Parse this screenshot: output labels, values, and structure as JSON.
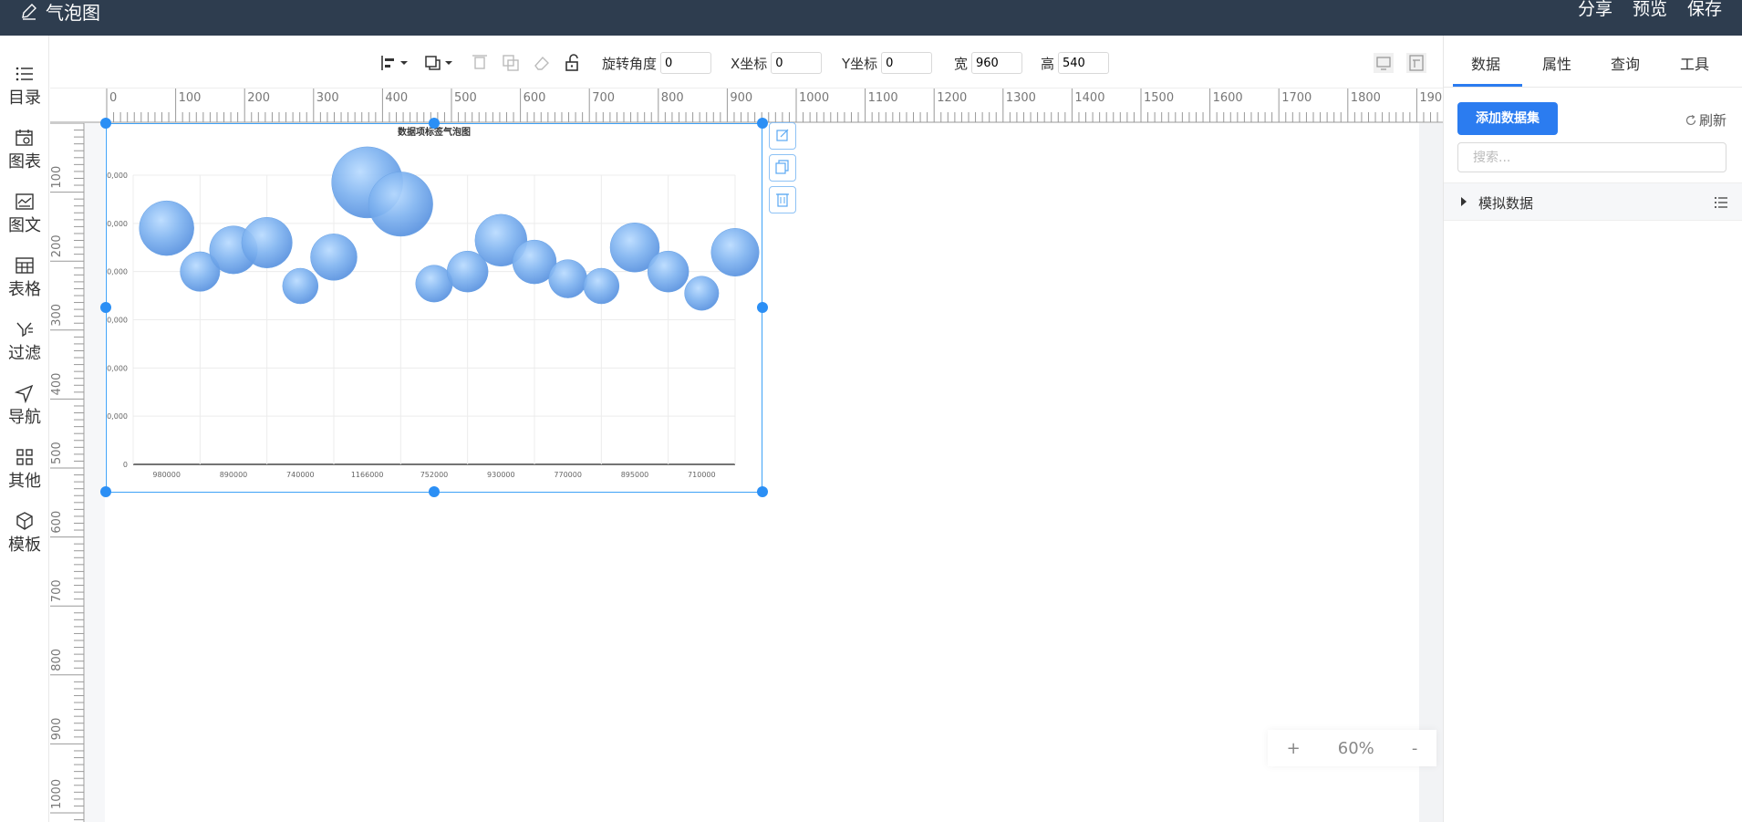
{
  "app": {
    "title": "气泡图"
  },
  "header": {
    "actions": [
      "分享",
      "预览",
      "保存"
    ]
  },
  "sidebar": {
    "items": [
      {
        "label": "目录",
        "icon": "list-icon"
      },
      {
        "label": "图表",
        "icon": "calendar-chart-icon"
      },
      {
        "label": "图文",
        "icon": "image-text-icon"
      },
      {
        "label": "表格",
        "icon": "table-icon"
      },
      {
        "label": "过滤",
        "icon": "filter-icon"
      },
      {
        "label": "导航",
        "icon": "navigation-icon"
      },
      {
        "label": "其他",
        "icon": "grid-icon"
      },
      {
        "label": "模板",
        "icon": "template-icon"
      }
    ]
  },
  "toolbar": {
    "rotate_label": "旋转角度",
    "rotate_value": "0",
    "x_label": "X坐标",
    "x_value": "0",
    "y_label": "Y坐标",
    "y_value": "0",
    "w_label": "宽",
    "w_value": "960",
    "h_label": "高",
    "h_value": "540"
  },
  "ruler": {
    "top_labels": [
      "0",
      "100",
      "200",
      "300",
      "400",
      "500",
      "600",
      "700",
      "800",
      "900",
      "1000",
      "1100",
      "1200",
      "1300",
      "1400",
      "1500",
      "1600",
      "1700",
      "1800",
      "1900"
    ],
    "left_labels": [
      "100",
      "200",
      "300",
      "400",
      "500",
      "600",
      "700",
      "800",
      "900",
      "1000"
    ]
  },
  "zoom": {
    "plus": "+",
    "value": "60%",
    "minus": "-"
  },
  "right_panel": {
    "tabs": [
      "数据",
      "属性",
      "查询",
      "工具"
    ],
    "active_tab": "数据",
    "add_dataset_label": "添加数据集",
    "refresh_label": "刷新",
    "search_placeholder": "搜索...",
    "dataset_name": "模拟数据"
  },
  "colors": {
    "topbar": "#2e3d4f",
    "accent": "#2b7cf0",
    "bubble": "#6aa8ee",
    "selection": "#3ea2f7"
  },
  "chart_data": {
    "type": "scatter",
    "title": "数据项标签气泡图",
    "y_ticks": [
      "0",
      "10,000",
      "20,000",
      "30,000",
      "40,000",
      "50,000",
      "60,000"
    ],
    "ylim": [
      0,
      60000
    ],
    "x_tick_labels": [
      "980000",
      "890000",
      "740000",
      "1166000",
      "752000",
      "930000",
      "770000",
      "895000",
      "710000"
    ],
    "points": [
      {
        "x": 0,
        "y": 49000,
        "size": 40
      },
      {
        "x": 0.5,
        "y": 40000,
        "size": 29
      },
      {
        "x": 1,
        "y": 44500,
        "size": 35
      },
      {
        "x": 1.5,
        "y": 46000,
        "size": 37
      },
      {
        "x": 2,
        "y": 37000,
        "size": 26
      },
      {
        "x": 2.5,
        "y": 43000,
        "size": 34
      },
      {
        "x": 3,
        "y": 58500,
        "size": 52
      },
      {
        "x": 3.5,
        "y": 54000,
        "size": 47
      },
      {
        "x": 4,
        "y": 37500,
        "size": 27
      },
      {
        "x": 4.5,
        "y": 40000,
        "size": 30
      },
      {
        "x": 5,
        "y": 46500,
        "size": 38
      },
      {
        "x": 5.5,
        "y": 42000,
        "size": 32
      },
      {
        "x": 6,
        "y": 38500,
        "size": 28
      },
      {
        "x": 6.5,
        "y": 37000,
        "size": 26
      },
      {
        "x": 7,
        "y": 45000,
        "size": 36
      },
      {
        "x": 7.5,
        "y": 40000,
        "size": 30
      },
      {
        "x": 8,
        "y": 35500,
        "size": 25
      },
      {
        "x": 8.5,
        "y": 44000,
        "size": 35
      }
    ],
    "grid": true
  }
}
